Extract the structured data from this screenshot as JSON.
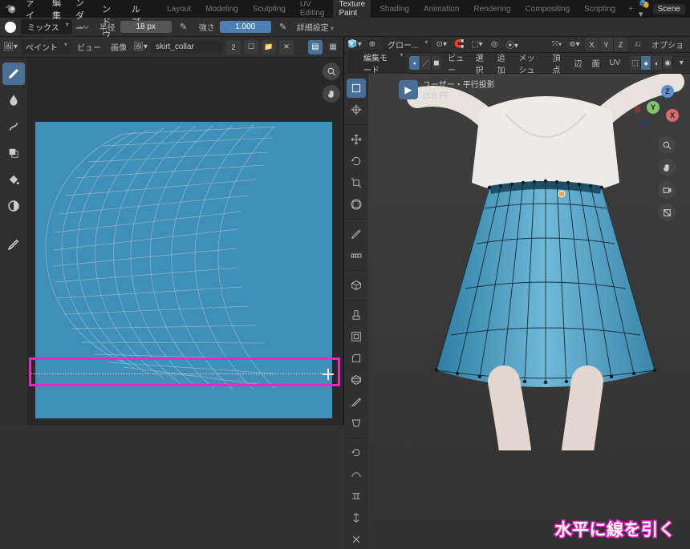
{
  "menu": {
    "file": "ファイル",
    "edit": "編集",
    "render": "レンダー",
    "window": "ウィンドウ",
    "help": "ヘルプ"
  },
  "workspaces": {
    "layout": "Layout",
    "modeling": "Modeling",
    "sculpting": "Sculpting",
    "uv": "UV Editing",
    "texpaint": "Texture Paint",
    "shading": "Shading",
    "animation": "Animation",
    "rendering": "Rendering",
    "compositing": "Compositing",
    "scripting": "Scripting"
  },
  "scene": {
    "label": "Scene"
  },
  "tool": {
    "blend": "ミックス",
    "radius_label": "半径",
    "radius_value": "18 px",
    "strength_label": "強さ",
    "strength_value": "1.000",
    "advanced": "詳細設定"
  },
  "left_header": {
    "mode": "ペイント",
    "view": "ビュー",
    "image": "画像",
    "imgname": "skirt_collar"
  },
  "right_header": {
    "mode": "編集モード",
    "global": "グロー...",
    "view": "ビュー",
    "menu_select": "選択",
    "menu_add": "追加",
    "menu_mesh": "メッシュ",
    "menu_vertex": "頂点",
    "menu_edge": "辺",
    "menu_face": "面",
    "menu_uv": "UV",
    "options": "オプショ"
  },
  "viewport": {
    "title": "ユーザー・平行投影",
    "subtitle": "(53) 円"
  },
  "axes": {
    "x": "X",
    "y": "Y",
    "z": "Z"
  },
  "annotation": "水平に線を引く"
}
